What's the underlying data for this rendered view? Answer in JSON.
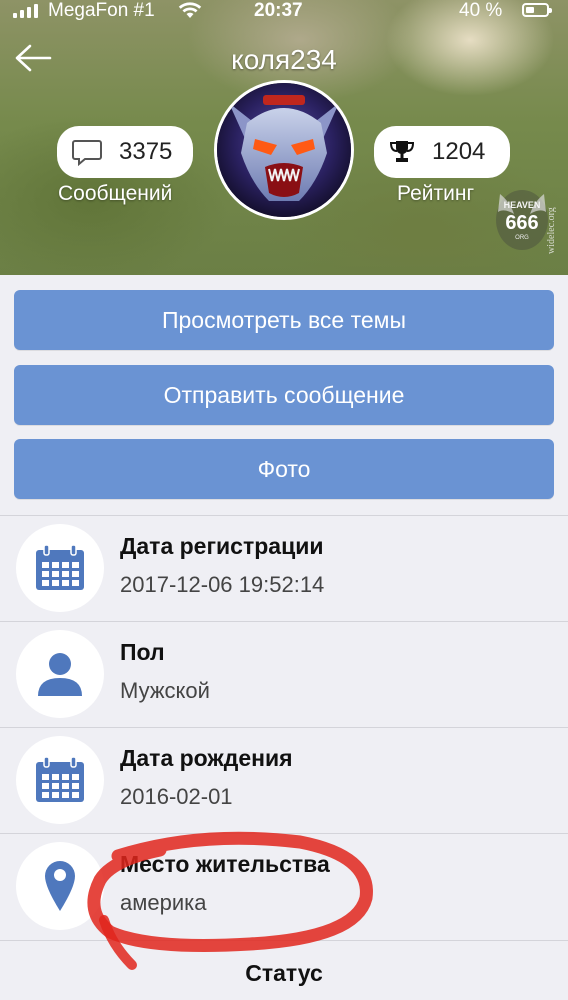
{
  "status_bar": {
    "carrier": "MegaFon #1",
    "time": "20:37",
    "battery_percent": "40 %",
    "battery_level": 0.4
  },
  "header": {
    "title": "коля234",
    "back_icon": "arrow-left-icon",
    "messages": {
      "count": "3375",
      "label": "Сообщений",
      "icon": "chat-bubble-icon"
    },
    "rating": {
      "count": "1204",
      "label": "Рейтинг",
      "icon": "trophy-icon"
    },
    "watermark": {
      "brand": "HEAVEN",
      "number": "666",
      "suffix": "ORG",
      "side_text": "widelec.org"
    }
  },
  "actions": {
    "view_topics": "Просмотреть все темы",
    "send_message": "Отправить сообщение",
    "photo": "Фото"
  },
  "profile": {
    "registration": {
      "label": "Дата регистрации",
      "value": "2017-12-06 19:52:14",
      "icon": "calendar-icon"
    },
    "gender": {
      "label": "Пол",
      "value": "Мужской",
      "icon": "person-icon"
    },
    "birthday": {
      "label": "Дата рождения",
      "value": "2016-02-01",
      "icon": "calendar-icon"
    },
    "residence": {
      "label": "Место жительства",
      "value": "америка",
      "icon": "map-pin-icon"
    }
  },
  "status_section": {
    "heading": "Статус"
  },
  "colors": {
    "button_blue": "#6a93d3",
    "icon_blue": "#4f78bd",
    "highlight_red": "#e0261c",
    "background": "#efeff4"
  }
}
